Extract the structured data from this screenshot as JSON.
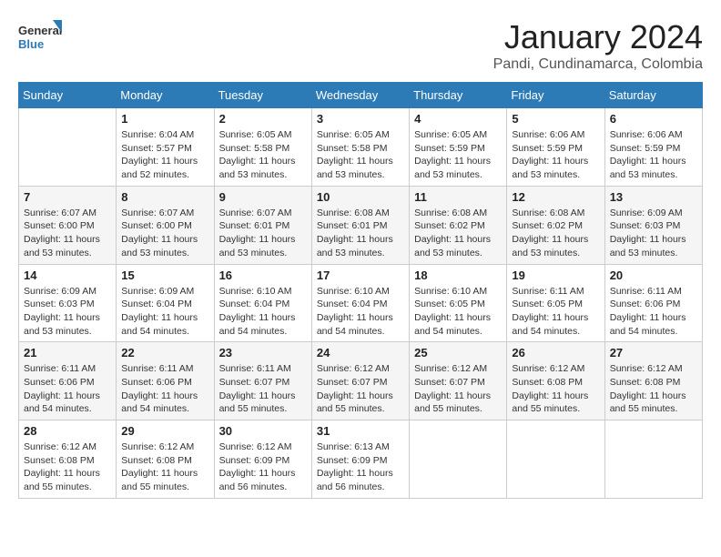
{
  "logo": {
    "general": "General",
    "blue": "Blue"
  },
  "title": "January 2024",
  "location": "Pandi, Cundinamarca, Colombia",
  "days_of_week": [
    "Sunday",
    "Monday",
    "Tuesday",
    "Wednesday",
    "Thursday",
    "Friday",
    "Saturday"
  ],
  "weeks": [
    [
      {
        "num": "",
        "sunrise": "",
        "sunset": "",
        "daylight": ""
      },
      {
        "num": "1",
        "sunrise": "Sunrise: 6:04 AM",
        "sunset": "Sunset: 5:57 PM",
        "daylight": "Daylight: 11 hours and 52 minutes."
      },
      {
        "num": "2",
        "sunrise": "Sunrise: 6:05 AM",
        "sunset": "Sunset: 5:58 PM",
        "daylight": "Daylight: 11 hours and 53 minutes."
      },
      {
        "num": "3",
        "sunrise": "Sunrise: 6:05 AM",
        "sunset": "Sunset: 5:58 PM",
        "daylight": "Daylight: 11 hours and 53 minutes."
      },
      {
        "num": "4",
        "sunrise": "Sunrise: 6:05 AM",
        "sunset": "Sunset: 5:59 PM",
        "daylight": "Daylight: 11 hours and 53 minutes."
      },
      {
        "num": "5",
        "sunrise": "Sunrise: 6:06 AM",
        "sunset": "Sunset: 5:59 PM",
        "daylight": "Daylight: 11 hours and 53 minutes."
      },
      {
        "num": "6",
        "sunrise": "Sunrise: 6:06 AM",
        "sunset": "Sunset: 5:59 PM",
        "daylight": "Daylight: 11 hours and 53 minutes."
      }
    ],
    [
      {
        "num": "7",
        "sunrise": "Sunrise: 6:07 AM",
        "sunset": "Sunset: 6:00 PM",
        "daylight": "Daylight: 11 hours and 53 minutes."
      },
      {
        "num": "8",
        "sunrise": "Sunrise: 6:07 AM",
        "sunset": "Sunset: 6:00 PM",
        "daylight": "Daylight: 11 hours and 53 minutes."
      },
      {
        "num": "9",
        "sunrise": "Sunrise: 6:07 AM",
        "sunset": "Sunset: 6:01 PM",
        "daylight": "Daylight: 11 hours and 53 minutes."
      },
      {
        "num": "10",
        "sunrise": "Sunrise: 6:08 AM",
        "sunset": "Sunset: 6:01 PM",
        "daylight": "Daylight: 11 hours and 53 minutes."
      },
      {
        "num": "11",
        "sunrise": "Sunrise: 6:08 AM",
        "sunset": "Sunset: 6:02 PM",
        "daylight": "Daylight: 11 hours and 53 minutes."
      },
      {
        "num": "12",
        "sunrise": "Sunrise: 6:08 AM",
        "sunset": "Sunset: 6:02 PM",
        "daylight": "Daylight: 11 hours and 53 minutes."
      },
      {
        "num": "13",
        "sunrise": "Sunrise: 6:09 AM",
        "sunset": "Sunset: 6:03 PM",
        "daylight": "Daylight: 11 hours and 53 minutes."
      }
    ],
    [
      {
        "num": "14",
        "sunrise": "Sunrise: 6:09 AM",
        "sunset": "Sunset: 6:03 PM",
        "daylight": "Daylight: 11 hours and 53 minutes."
      },
      {
        "num": "15",
        "sunrise": "Sunrise: 6:09 AM",
        "sunset": "Sunset: 6:04 PM",
        "daylight": "Daylight: 11 hours and 54 minutes."
      },
      {
        "num": "16",
        "sunrise": "Sunrise: 6:10 AM",
        "sunset": "Sunset: 6:04 PM",
        "daylight": "Daylight: 11 hours and 54 minutes."
      },
      {
        "num": "17",
        "sunrise": "Sunrise: 6:10 AM",
        "sunset": "Sunset: 6:04 PM",
        "daylight": "Daylight: 11 hours and 54 minutes."
      },
      {
        "num": "18",
        "sunrise": "Sunrise: 6:10 AM",
        "sunset": "Sunset: 6:05 PM",
        "daylight": "Daylight: 11 hours and 54 minutes."
      },
      {
        "num": "19",
        "sunrise": "Sunrise: 6:11 AM",
        "sunset": "Sunset: 6:05 PM",
        "daylight": "Daylight: 11 hours and 54 minutes."
      },
      {
        "num": "20",
        "sunrise": "Sunrise: 6:11 AM",
        "sunset": "Sunset: 6:06 PM",
        "daylight": "Daylight: 11 hours and 54 minutes."
      }
    ],
    [
      {
        "num": "21",
        "sunrise": "Sunrise: 6:11 AM",
        "sunset": "Sunset: 6:06 PM",
        "daylight": "Daylight: 11 hours and 54 minutes."
      },
      {
        "num": "22",
        "sunrise": "Sunrise: 6:11 AM",
        "sunset": "Sunset: 6:06 PM",
        "daylight": "Daylight: 11 hours and 54 minutes."
      },
      {
        "num": "23",
        "sunrise": "Sunrise: 6:11 AM",
        "sunset": "Sunset: 6:07 PM",
        "daylight": "Daylight: 11 hours and 55 minutes."
      },
      {
        "num": "24",
        "sunrise": "Sunrise: 6:12 AM",
        "sunset": "Sunset: 6:07 PM",
        "daylight": "Daylight: 11 hours and 55 minutes."
      },
      {
        "num": "25",
        "sunrise": "Sunrise: 6:12 AM",
        "sunset": "Sunset: 6:07 PM",
        "daylight": "Daylight: 11 hours and 55 minutes."
      },
      {
        "num": "26",
        "sunrise": "Sunrise: 6:12 AM",
        "sunset": "Sunset: 6:08 PM",
        "daylight": "Daylight: 11 hours and 55 minutes."
      },
      {
        "num": "27",
        "sunrise": "Sunrise: 6:12 AM",
        "sunset": "Sunset: 6:08 PM",
        "daylight": "Daylight: 11 hours and 55 minutes."
      }
    ],
    [
      {
        "num": "28",
        "sunrise": "Sunrise: 6:12 AM",
        "sunset": "Sunset: 6:08 PM",
        "daylight": "Daylight: 11 hours and 55 minutes."
      },
      {
        "num": "29",
        "sunrise": "Sunrise: 6:12 AM",
        "sunset": "Sunset: 6:08 PM",
        "daylight": "Daylight: 11 hours and 55 minutes."
      },
      {
        "num": "30",
        "sunrise": "Sunrise: 6:12 AM",
        "sunset": "Sunset: 6:09 PM",
        "daylight": "Daylight: 11 hours and 56 minutes."
      },
      {
        "num": "31",
        "sunrise": "Sunrise: 6:13 AM",
        "sunset": "Sunset: 6:09 PM",
        "daylight": "Daylight: 11 hours and 56 minutes."
      },
      {
        "num": "",
        "sunrise": "",
        "sunset": "",
        "daylight": ""
      },
      {
        "num": "",
        "sunrise": "",
        "sunset": "",
        "daylight": ""
      },
      {
        "num": "",
        "sunrise": "",
        "sunset": "",
        "daylight": ""
      }
    ]
  ]
}
